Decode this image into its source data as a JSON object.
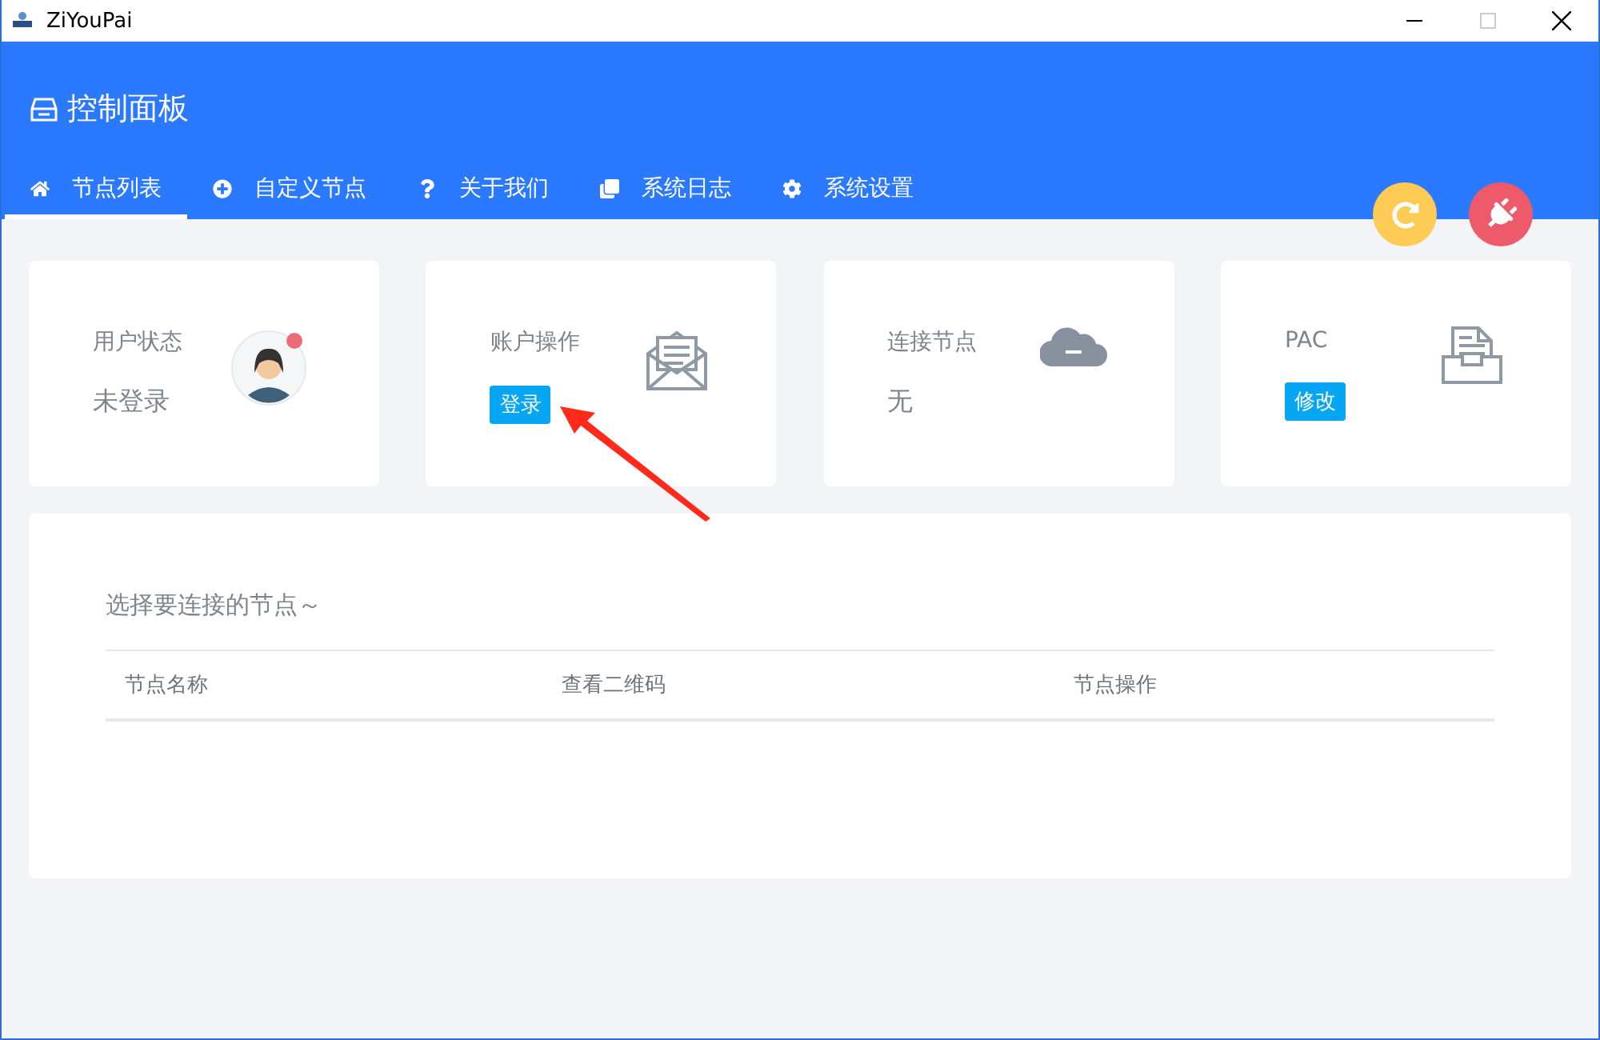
{
  "window": {
    "title": "ZiYouPai"
  },
  "header": {
    "title": "控制面板"
  },
  "tabs": [
    {
      "label": "节点列表",
      "selected": true
    },
    {
      "label": "自定义节点",
      "selected": false
    },
    {
      "label": "关于我们",
      "selected": false
    },
    {
      "label": "系统日志",
      "selected": false
    },
    {
      "label": "系统设置",
      "selected": false
    }
  ],
  "action_buttons": [
    {
      "color": "#fecb54"
    },
    {
      "color": "#ef5a6b"
    }
  ],
  "cards": [
    {
      "kind": "text",
      "label": "用户状态",
      "value": "未登录"
    },
    {
      "kind": "button",
      "label": "账户操作",
      "button": "登录"
    },
    {
      "kind": "text",
      "label": "连接节点",
      "value": "无"
    },
    {
      "kind": "button",
      "label": "PAC",
      "button": "修改"
    }
  ],
  "nodes": {
    "title": "选择要连接的节点～",
    "columns": [
      "节点名称",
      "查看二维码",
      "节点操作"
    ]
  }
}
